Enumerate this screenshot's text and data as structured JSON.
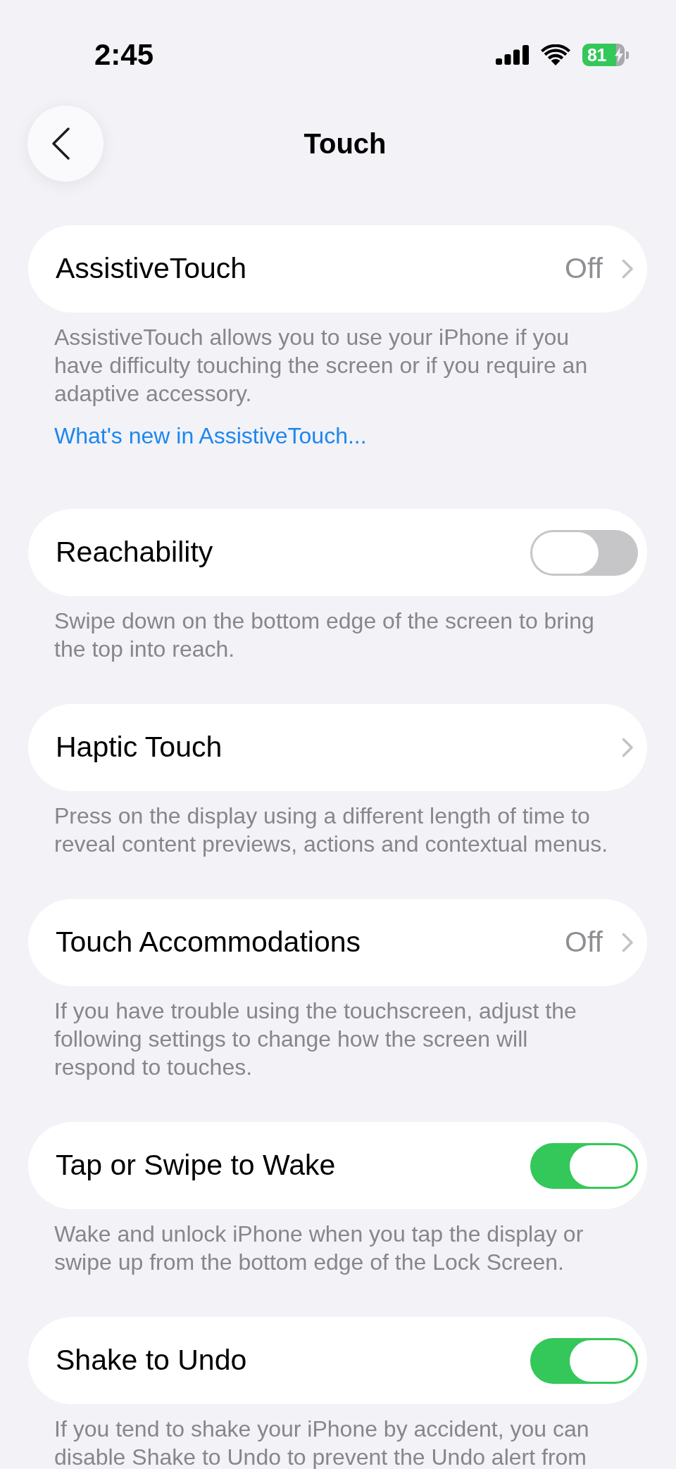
{
  "status_bar": {
    "time": "2:45",
    "battery": {
      "label": "81",
      "charging": true
    }
  },
  "nav": {
    "title": "Touch"
  },
  "sections": [
    {
      "row": {
        "kind": "disclosure",
        "label": "AssistiveTouch",
        "value": "Off"
      },
      "footer": "AssistiveTouch allows you to use your iPhone if you have difficulty touching the screen or if you require an adaptive accessory.",
      "footer_link": "What's new in AssistiveTouch..."
    },
    {
      "row": {
        "kind": "toggle",
        "label": "Reachability",
        "on": false
      },
      "footer": "Swipe down on the bottom edge of the screen to bring the top into reach."
    },
    {
      "row": {
        "kind": "disclosure",
        "label": "Haptic Touch"
      },
      "footer": "Press on the display using a different length of time to reveal content previews, actions and contextual menus."
    },
    {
      "row": {
        "kind": "disclosure",
        "label": "Touch Accommodations",
        "value": "Off"
      },
      "footer": "If you have trouble using the touchscreen, adjust the following settings to change how the screen will respond to touches."
    },
    {
      "row": {
        "kind": "toggle",
        "label": "Tap or Swipe to Wake",
        "on": true
      },
      "footer": "Wake and unlock iPhone when you tap the display or swipe up from the bottom edge of the Lock Screen."
    },
    {
      "row": {
        "kind": "toggle",
        "label": "Shake to Undo",
        "on": true
      },
      "footer": "If you tend to shake your iPhone by accident, you can disable Shake to Undo to prevent the Undo alert from"
    }
  ]
}
